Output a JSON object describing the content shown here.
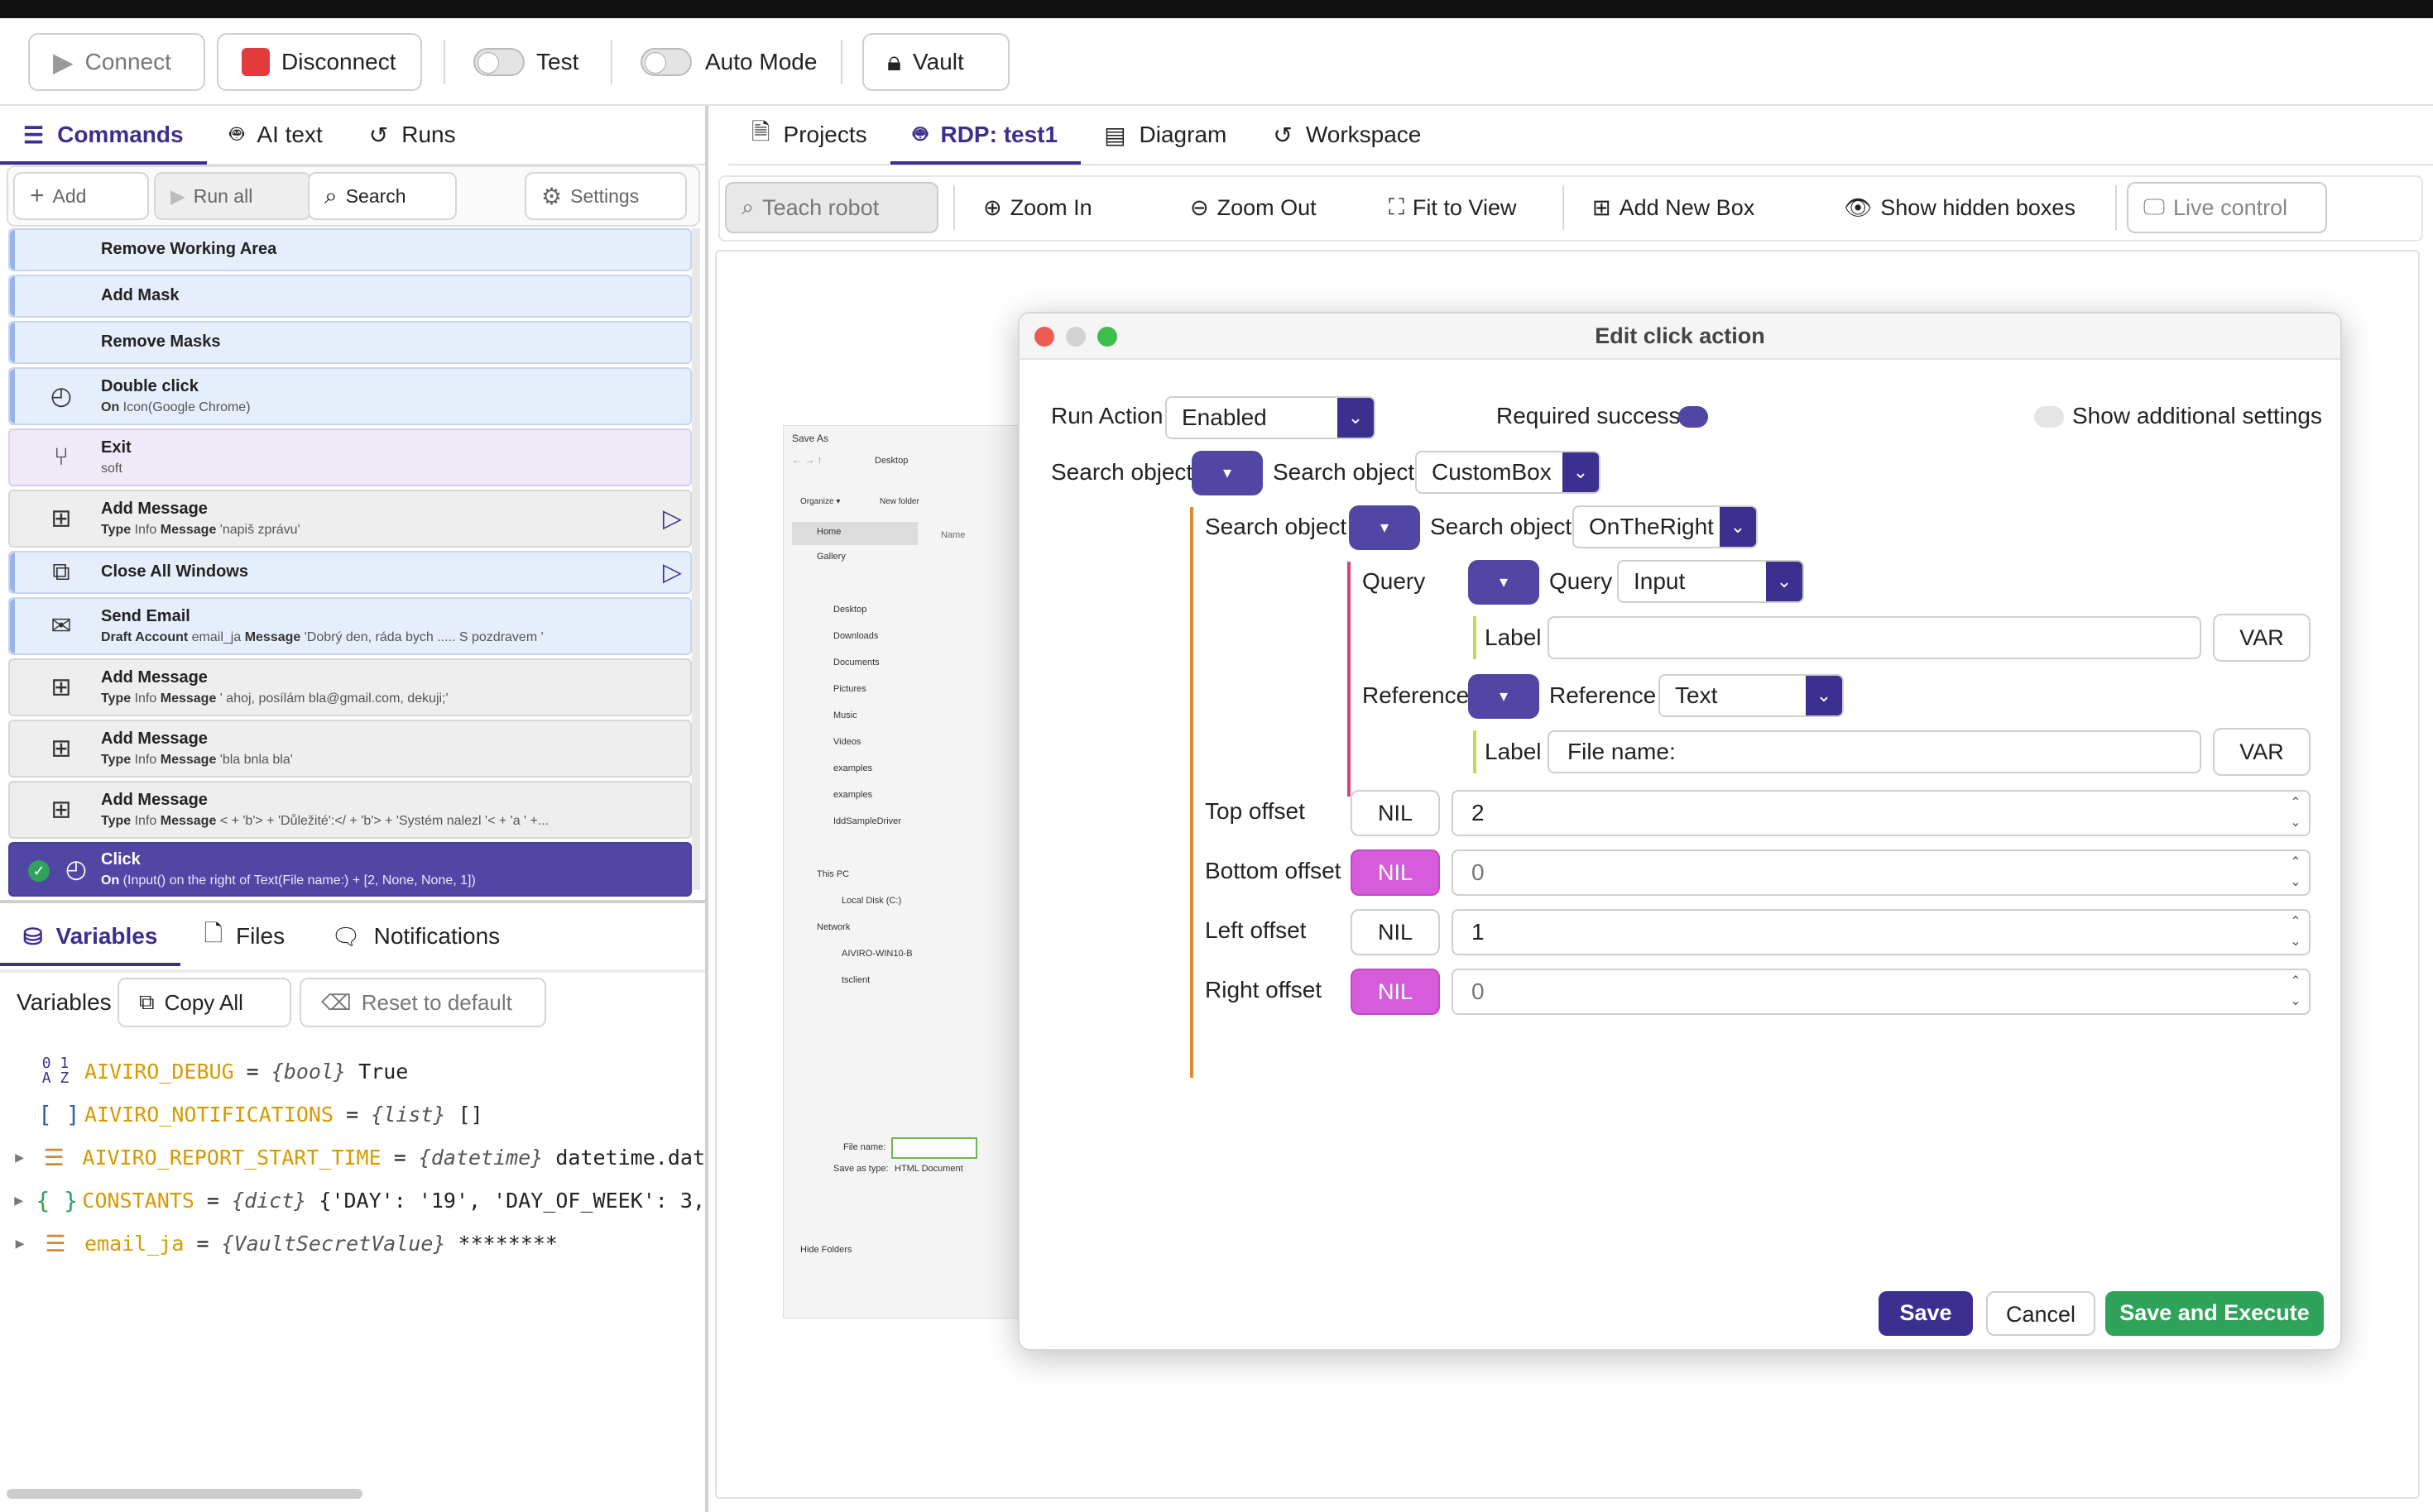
{
  "toolbar": {
    "connect": "Connect",
    "disconnect": "Disconnect",
    "test": "Test",
    "auto_mode": "Auto Mode",
    "vault": "Vault"
  },
  "left_tabs": [
    "Commands",
    "AI text",
    "Runs"
  ],
  "commands_bar": {
    "add": "Add",
    "run_all": "Run all",
    "search": "Search",
    "settings": "Settings"
  },
  "commands": [
    {
      "title": "Remove Working Area",
      "sub": ""
    },
    {
      "title": "Add Mask",
      "sub": ""
    },
    {
      "title": "Remove Masks",
      "sub": ""
    },
    {
      "title": "Double click",
      "sub_key": "On",
      "sub": "Icon(Google Chrome)"
    },
    {
      "title": "Exit",
      "sub": "soft"
    },
    {
      "title": "Add Message",
      "sub_key": "Type",
      "sub": "Info",
      "sub_key2": "Message",
      "sub2": "'napiš zprávu'"
    },
    {
      "title": "Close All Windows",
      "sub": ""
    },
    {
      "title": "Send Email",
      "sub_key": "Draft Account",
      "sub": "email_ja",
      "sub_key2": "Message",
      "sub2": "'Dobrý den, ráda bych ..... S pozdravem '"
    },
    {
      "title": "Add Message",
      "sub_key": "Type",
      "sub": "Info",
      "sub_key2": "Message",
      "sub2": "' ahoj, posílám bla@gmail.com, dekuji;'"
    },
    {
      "title": "Add Message",
      "sub_key": "Type",
      "sub": "Info",
      "sub_key2": "Message",
      "sub2": "'bla bnla bla'"
    },
    {
      "title": "Add Message",
      "sub_key": "Type",
      "sub": "Info",
      "sub_key2": "Message",
      "sub2": "< + 'b'> + 'Důležité':</ + 'b'> + 'Systém nalezl '< + 'a ' +..."
    },
    {
      "title": "Click",
      "sub_key": "On",
      "sub": "(Input() on the right of Text(File name:) + [2, None, None, 1])"
    }
  ],
  "bottom_tabs": [
    "Variables",
    "Files",
    "Notifications"
  ],
  "variables_bar": {
    "label": "Variables",
    "copy_all": "Copy All",
    "reset": "Reset to default"
  },
  "variables": [
    {
      "name": "AIVIRO_DEBUG",
      "type": "{bool}",
      "value": "True"
    },
    {
      "name": "AIVIRO_NOTIFICATIONS",
      "type": "{list}",
      "value": "[]"
    },
    {
      "name": "AIVIRO_REPORT_START_TIME",
      "type": "{datetime}",
      "value": "datetime.dat"
    },
    {
      "name": "CONSTANTS",
      "type": "{dict}",
      "value": "{'DAY': '19', 'DAY_OF_WEEK': 3,"
    },
    {
      "name": "email_ja",
      "type": "{VaultSecretValue}",
      "value": "********"
    }
  ],
  "right_tabs": [
    "Projects",
    "RDP: test1",
    "Diagram",
    "Workspace"
  ],
  "right_toolbar": {
    "teach": "Teach robot",
    "zoom_in": "Zoom In",
    "zoom_out": "Zoom Out",
    "fit": "Fit to View",
    "add_box": "Add New Box",
    "show_hidden": "Show hidden boxes",
    "live": "Live control"
  },
  "screenshot": {
    "title": "Save As",
    "path": "Desktop",
    "organize": "Organize ▾",
    "new_folder": "New folder",
    "name_col": "Name",
    "items": [
      "Home",
      "Gallery",
      "Desktop",
      "Downloads",
      "Documents",
      "Pictures",
      "Music",
      "Videos",
      "examples",
      "examples",
      "IddSampleDriver",
      "This PC",
      "Local Disk (C:)",
      "Network",
      "AIVIRO-WIN10-B",
      "tsclient"
    ],
    "file_name": "File name:",
    "save_type_label": "Save as type:",
    "save_type": "HTML Document",
    "hide_folders": "Hide Folders"
  },
  "dialog": {
    "title": "Edit click action",
    "run_action_label": "Run Action",
    "run_action_value": "Enabled",
    "required_success": "Required success",
    "show_additional": "Show additional settings",
    "search_object_label": "Search object",
    "search_object_value": "CustomBox",
    "search_object2_value": "OnTheRight",
    "query_label": "Query",
    "query_value": "Input",
    "label_label": "Label",
    "label_value": "",
    "var_label": "VAR",
    "reference_label": "Reference",
    "reference_value": "Text",
    "reference_label_value": "File name:",
    "offsets": [
      {
        "label": "Top offset",
        "nil": "NIL",
        "value": "2",
        "nil_active": false
      },
      {
        "label": "Bottom offset",
        "nil": "NIL",
        "value": "0",
        "nil_active": true
      },
      {
        "label": "Left offset",
        "nil": "NIL",
        "value": "1",
        "nil_active": false
      },
      {
        "label": "Right offset",
        "nil": "NIL",
        "value": "0",
        "nil_active": true
      }
    ],
    "save": "Save",
    "cancel": "Cancel",
    "save_execute": "Save and Execute"
  },
  "colors": {
    "accent": "#3b2f8f",
    "nil_active": "#d65cdb",
    "success": "#2fa35a"
  }
}
